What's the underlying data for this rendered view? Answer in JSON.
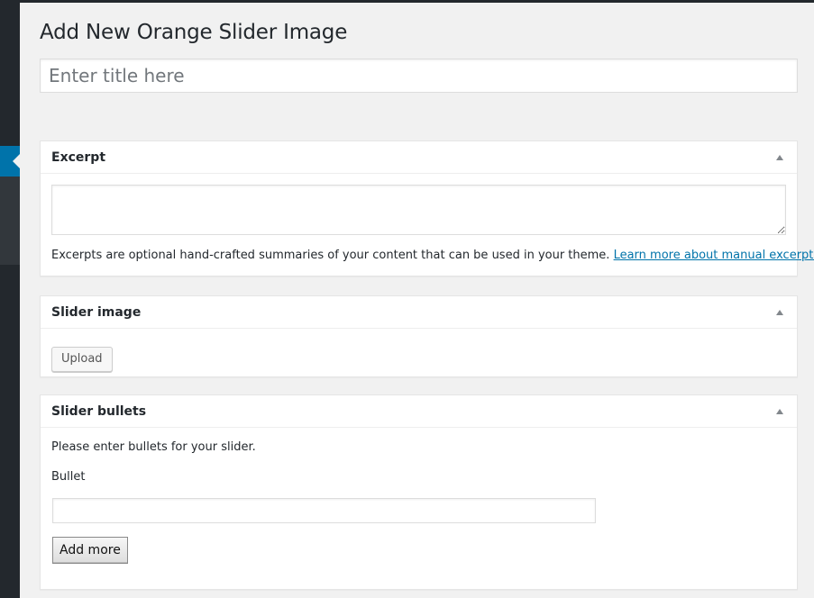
{
  "page": {
    "title": "Add New Orange Slider Image"
  },
  "title_field": {
    "placeholder": "Enter title here",
    "value": ""
  },
  "excerpt_box": {
    "title": "Excerpt",
    "textarea_value": "",
    "help_text": "Excerpts are optional hand-crafted summaries of your content that can be used in your theme.",
    "help_link_label": "Learn more about manual excerpts."
  },
  "slider_image_box": {
    "title": "Slider image",
    "upload_label": "Upload"
  },
  "slider_bullets_box": {
    "title": "Slider bullets",
    "intro_text": "Please enter bullets for your slider.",
    "bullet_label": "Bullet",
    "bullet_value": "",
    "add_more_label": "Add more"
  },
  "colors": {
    "admin_bar": "#23282d",
    "active_menu": "#0073aa",
    "link": "#0073aa",
    "background": "#f1f1f1"
  },
  "icons": {
    "postbox_toggle": "triangle-up-icon",
    "textarea_resize": "resize-grip-icon"
  }
}
